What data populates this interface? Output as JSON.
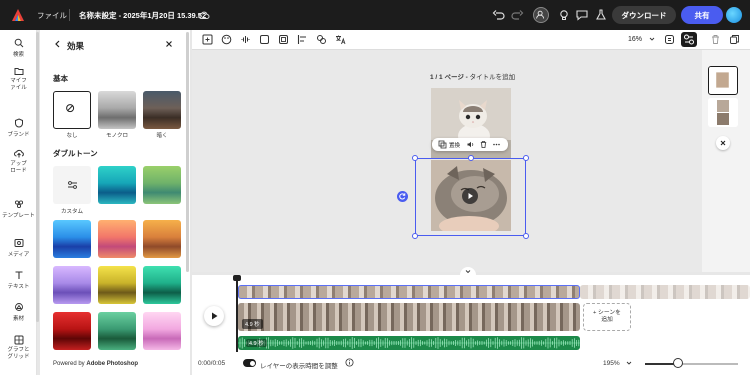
{
  "topbar": {
    "file_menu": "ファイル",
    "doc_title": "名称未設定 - 2025年1月20日 15.39.52",
    "download_label": "ダウンロード",
    "share_label": "共有"
  },
  "rail": {
    "items": [
      {
        "label": "検索",
        "icon": "search-icon"
      },
      {
        "label": "マイファイル",
        "icon": "folder-icon"
      },
      {
        "label": "ブランド",
        "icon": "brand-icon"
      },
      {
        "label": "アップロード",
        "icon": "upload-icon"
      },
      {
        "label": "テンプレート",
        "icon": "template-icon"
      },
      {
        "label": "メディア",
        "icon": "media-icon"
      },
      {
        "label": "テキスト",
        "icon": "text-icon"
      },
      {
        "label": "素材",
        "icon": "elements-icon"
      },
      {
        "label": "グラフとグリッド",
        "icon": "chart-icon"
      }
    ]
  },
  "panel": {
    "title": "効果",
    "section_basic": "基本",
    "section_duotone": "ダブルトーン",
    "basic_effects": [
      {
        "label": "なし"
      },
      {
        "label": "モノクロ"
      },
      {
        "label": "暗く"
      }
    ],
    "duotone_custom_label": "カスタム",
    "powered_prefix": "Powered by ",
    "powered_brand": "Adobe Photoshop"
  },
  "canvas_toolbar": {
    "zoom": "16%"
  },
  "canvas": {
    "page_prefix": "1 / 1 ページ - ",
    "page_title_placeholder": "タイトルを追加",
    "float_replace": "置換"
  },
  "timeline": {
    "duration_badge": "4.9 秒",
    "audio_badge": "4.9 秒",
    "add_scene_line1": "+ シーンを",
    "add_scene_line2": "追加",
    "time_readout": "0:00/0:05",
    "toggle_label": "レイヤーの表示時間を調整",
    "zoom": "195%",
    "zoom_slider_fraction": 0.36
  },
  "colors": {
    "accent": "#4a5cf0",
    "audio_track": "#1d8a4a",
    "topbar": "#1c1c1c"
  }
}
